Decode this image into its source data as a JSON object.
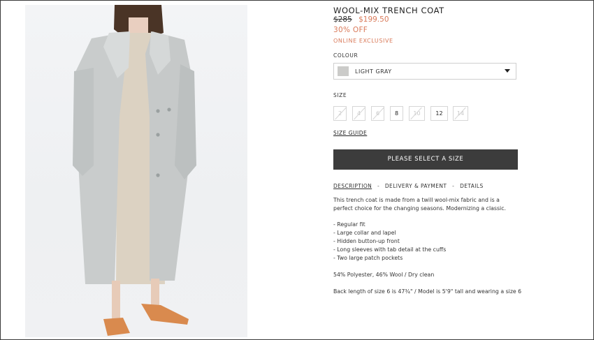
{
  "product": {
    "title": "WOOL-MIX TRENCH COAT",
    "old_price": "$285",
    "new_price": "$199.50",
    "discount": "30% OFF",
    "exclusive": "ONLINE EXCLUSIVE"
  },
  "colour": {
    "label": "COLOUR",
    "selected": "LIGHT GRAY",
    "swatch_color": "#cbcbc9"
  },
  "size": {
    "label": "SIZE",
    "options": [
      {
        "label": "2",
        "available": false
      },
      {
        "label": "4",
        "available": false
      },
      {
        "label": "6",
        "available": false
      },
      {
        "label": "8",
        "available": true
      },
      {
        "label": "10",
        "available": false
      },
      {
        "label": "12",
        "available": true
      },
      {
        "label": "14",
        "available": false
      }
    ],
    "guide": "SIZE GUIDE"
  },
  "cta": {
    "label": "PLEASE SELECT A SIZE"
  },
  "tabs": [
    {
      "label": "DESCRIPTION",
      "active": true
    },
    {
      "label": "DELIVERY & PAYMENT",
      "active": false
    },
    {
      "label": "DETAILS",
      "active": false
    }
  ],
  "tab_separator": "-",
  "description": {
    "intro": "This trench coat is made from a twill wool-mix fabric and is a perfect choice for the changing seasons. Modernizing a classic.",
    "features": [
      "Regular fit",
      "Large collar and lapel",
      "Hidden button-up front",
      "Long sleeves with tab detail at the cuffs",
      "Two large patch pockets"
    ],
    "composition": "54% Polyester, 46% Wool / Dry clean",
    "fit_note": "Back length of size 6 is 47¾\" / Model is 5'9\" tall and wearing a size 6"
  },
  "colors": {
    "accent": "#d97a5a",
    "button": "#3c3c3c"
  }
}
